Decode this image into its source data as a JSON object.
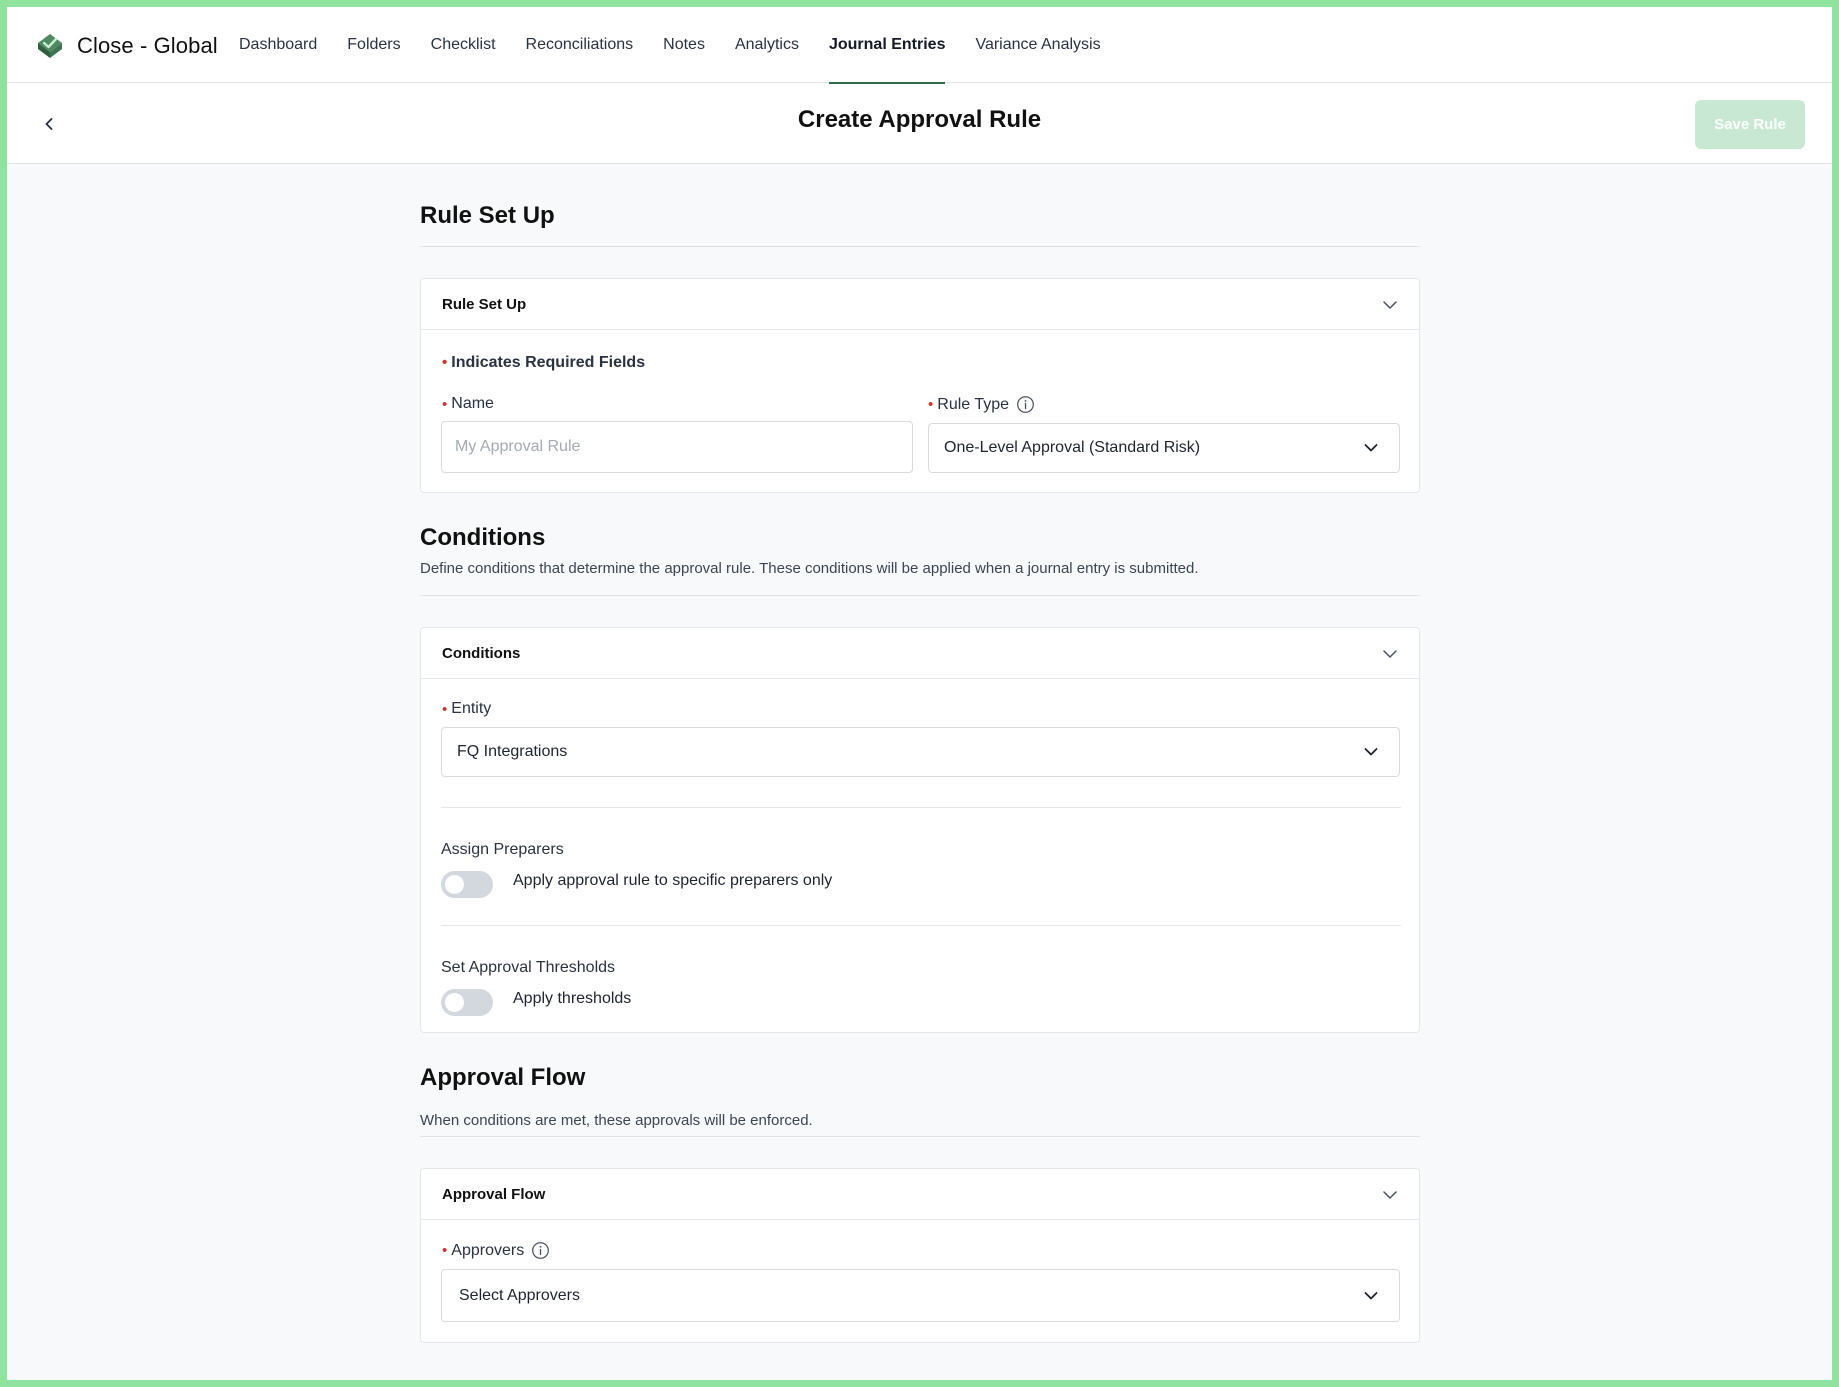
{
  "app": {
    "title": "Close - Global",
    "nav": [
      {
        "label": "Dashboard",
        "active": false
      },
      {
        "label": "Folders",
        "active": false
      },
      {
        "label": "Checklist",
        "active": false
      },
      {
        "label": "Reconciliations",
        "active": false
      },
      {
        "label": "Notes",
        "active": false
      },
      {
        "label": "Analytics",
        "active": false
      },
      {
        "label": "Journal Entries",
        "active": true
      },
      {
        "label": "Variance Analysis",
        "active": false
      }
    ]
  },
  "header": {
    "title": "Create Approval Rule",
    "save_label": "Save Rule",
    "back_icon": "chevron-left-icon"
  },
  "rule_setup": {
    "section_title": "Rule Set Up",
    "card_title": "Rule Set Up",
    "required_note": "Indicates Required Fields",
    "name_label": "Name",
    "name_placeholder": "My Approval Rule",
    "name_value": "",
    "rule_type_label": "Rule Type",
    "rule_type_value": "One-Level Approval (Standard Risk)"
  },
  "conditions": {
    "section_title": "Conditions",
    "section_desc": "Define conditions that determine the approval rule. These conditions will be applied when a journal entry is submitted.",
    "card_title": "Conditions",
    "entity_label": "Entity",
    "entity_value": "FQ Integrations",
    "preparers_label": "Assign Preparers",
    "preparers_toggle_text": "Apply approval rule to specific preparers only",
    "preparers_toggle_on": false,
    "thresholds_label": "Set Approval Thresholds",
    "thresholds_toggle_text": "Apply thresholds",
    "thresholds_toggle_on": false
  },
  "approval_flow": {
    "section_title": "Approval Flow",
    "section_desc": "When conditions are met, these approvals will be enforced.",
    "card_title": "Approval Flow",
    "approvers_label": "Approvers",
    "approvers_value": "Select Approvers"
  },
  "colors": {
    "accent": "#2f6b4a",
    "save_disabled": "#c8e8d3",
    "required": "#d0342c",
    "toggle_off": "#d3d8df"
  }
}
